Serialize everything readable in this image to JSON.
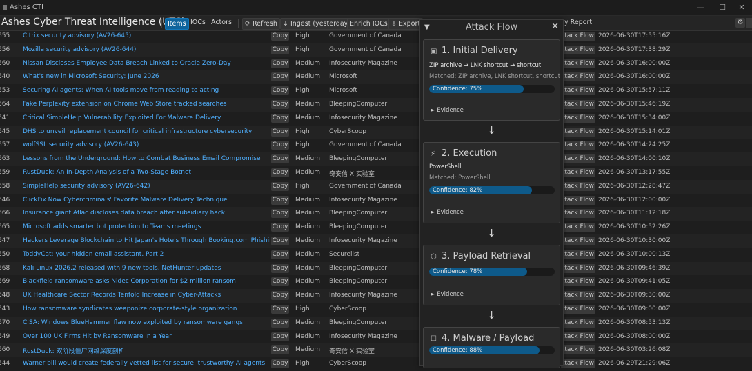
{
  "window": {
    "title": "Ashes CTI",
    "minimize": "—",
    "maximize": "☐",
    "close": "✕"
  },
  "toolbar": {
    "app_title": "Ashes Cyber Threat Intelligence (UTC)",
    "tabs": [
      "Items",
      "IOCs",
      "Actors"
    ],
    "refresh": "⟳ Refresh",
    "ingest": "↓ Ingest (yesterday)",
    "enrich": "Enrich IOCs",
    "export": "⇩ Export",
    "report": "y Report",
    "settings_icon": "⚙"
  },
  "table": {
    "copy_label": "Copy",
    "attack_label": "ttack Flow",
    "rows": [
      {
        "id": "655",
        "title": "Citrix security advisory (AV26-645)",
        "sev": "High",
        "src": "Government of Canada",
        "ts": "2026-06-30T17:55:16Z"
      },
      {
        "id": "656",
        "title": "Mozilla security advisory (AV26-644)",
        "sev": "High",
        "src": "Government of Canada",
        "ts": "2026-06-30T17:38:29Z"
      },
      {
        "id": "660",
        "title": "Nissan Discloses Employee Data Breach Linked to Oracle Zero-Day",
        "sev": "Medium",
        "src": "Infosecurity Magazine",
        "ts": "2026-06-30T16:00:00Z"
      },
      {
        "id": "640",
        "title": "What's new in Microsoft Security: June 2026",
        "sev": "Medium",
        "src": "Microsoft",
        "ts": "2026-06-30T16:00:00Z"
      },
      {
        "id": "653",
        "title": "Securing AI agents: When AI tools move from reading to acting",
        "sev": "High",
        "src": "Microsoft",
        "ts": "2026-06-30T15:57:11Z"
      },
      {
        "id": "664",
        "title": "Fake Perplexity extension on Chrome Web Store tracked searches",
        "sev": "Medium",
        "src": "BleepingComputer",
        "ts": "2026-06-30T15:46:19Z"
      },
      {
        "id": "641",
        "title": "Critical SimpleHelp Vulnerability Exploited For Malware Delivery",
        "sev": "Medium",
        "src": "Infosecurity Magazine",
        "ts": "2026-06-30T15:34:00Z"
      },
      {
        "id": "645",
        "title": "DHS to unveil replacement council for critical infrastructure cybersecurity",
        "sev": "High",
        "src": "CyberScoop",
        "ts": "2026-06-30T15:14:01Z"
      },
      {
        "id": "657",
        "title": "wolfSSL security advisory (AV26-643)",
        "sev": "High",
        "src": "Government of Canada",
        "ts": "2026-06-30T14:24:25Z"
      },
      {
        "id": "663",
        "title": "Lessons from the Underground: How to Combat Business Email Compromise",
        "sev": "Medium",
        "src": "BleepingComputer",
        "ts": "2026-06-30T14:00:10Z"
      },
      {
        "id": "659",
        "title": "RustDuck: An In-Depth Analysis of a Two-Stage Botnet",
        "sev": "Medium",
        "src": "奇安信 X 实验室",
        "ts": "2026-06-30T13:17:55Z"
      },
      {
        "id": "658",
        "title": "SimpleHelp security advisory (AV26-642)",
        "sev": "High",
        "src": "Government of Canada",
        "ts": "2026-06-30T12:28:47Z"
      },
      {
        "id": "646",
        "title": "ClickFix Now Cybercriminals' Favorite Malware Delivery Technique",
        "sev": "Medium",
        "src": "Infosecurity Magazine",
        "ts": "2026-06-30T12:00:00Z"
      },
      {
        "id": "666",
        "title": "Insurance giant Aflac discloses data breach after subsidiary hack",
        "sev": "Medium",
        "src": "BleepingComputer",
        "ts": "2026-06-30T11:12:18Z"
      },
      {
        "id": "665",
        "title": "Microsoft adds smarter bot protection to Teams meetings",
        "sev": "Medium",
        "src": "BleepingComputer",
        "ts": "2026-06-30T10:52:26Z"
      },
      {
        "id": "647",
        "title": "Hackers Leverage Blockchain to Hit Japan's Hotels Through Booking.com Phishing",
        "sev": "Medium",
        "src": "Infosecurity Magazine",
        "ts": "2026-06-30T10:30:00Z"
      },
      {
        "id": "650",
        "title": "ToddyCat: your hidden email assistant. Part 2",
        "sev": "Medium",
        "src": "Securelist",
        "ts": "2026-06-30T10:00:13Z"
      },
      {
        "id": "668",
        "title": "Kali Linux 2026.2 released with 9 new tools, NetHunter updates",
        "sev": "Medium",
        "src": "BleepingComputer",
        "ts": "2026-06-30T09:46:39Z"
      },
      {
        "id": "669",
        "title": "Blackfield ransomware asks Nidec Corporation for $2 million ransom",
        "sev": "Medium",
        "src": "BleepingComputer",
        "ts": "2026-06-30T09:41:05Z"
      },
      {
        "id": "648",
        "title": "UK Healthcare Sector Records Tenfold Increase in Cyber-Attacks",
        "sev": "Medium",
        "src": "Infosecurity Magazine",
        "ts": "2026-06-30T09:30:00Z"
      },
      {
        "id": "643",
        "title": "How ransomware syndicates weaponize corporate-style organization",
        "sev": "High",
        "src": "CyberScoop",
        "ts": "2026-06-30T09:00:00Z"
      },
      {
        "id": "670",
        "title": "CISA: Windows BlueHammer flaw now exploited by ransomware gangs",
        "sev": "Medium",
        "src": "BleepingComputer",
        "ts": "2026-06-30T08:53:13Z"
      },
      {
        "id": "649",
        "title": "Over 100 UK Firms Hit by Ransomware in a Year",
        "sev": "Medium",
        "src": "Infosecurity Magazine",
        "ts": "2026-06-30T08:00:00Z"
      },
      {
        "id": "660",
        "title": "RustDuck: 双阶段僵尸网络深度剖析",
        "sev": "Medium",
        "src": "奇安信 X 实验室",
        "ts": "2026-06-30T03:26:08Z"
      },
      {
        "id": "644",
        "title": "Warner bill would create federally vetted list for secure, trustworthy AI agents",
        "sev": "High",
        "src": "CyberScoop",
        "ts": "2026-06-29T21:29:06Z"
      }
    ]
  },
  "attack_flow": {
    "title": "Attack Flow",
    "collapse_icon": "▼",
    "close_icon": "✕",
    "arrow": "↓",
    "evidence_label": "► Evidence",
    "steps": [
      {
        "icon": "▣",
        "title": "1. Initial Delivery",
        "seq": "ZIP archive → LNK shortcut → shortcut",
        "matched": "Matched: ZIP archive, LNK shortcut, shortcut",
        "confidence": "Confidence: 75%",
        "conf_value": 0.75
      },
      {
        "icon": "⚡",
        "title": "2. Execution",
        "seq": "PowerShell",
        "matched": "Matched: PowerShell",
        "confidence": "Confidence: 82%",
        "conf_value": 0.82
      },
      {
        "icon": "⬡",
        "title": "3. Payload Retrieval",
        "seq": "",
        "matched": "",
        "confidence": "Confidence: 78%",
        "conf_value": 0.78
      },
      {
        "icon": "☐",
        "title": "4. Malware / Payload",
        "seq": "",
        "matched": "",
        "confidence": "Confidence: 88%",
        "conf_value": 0.88
      }
    ]
  }
}
